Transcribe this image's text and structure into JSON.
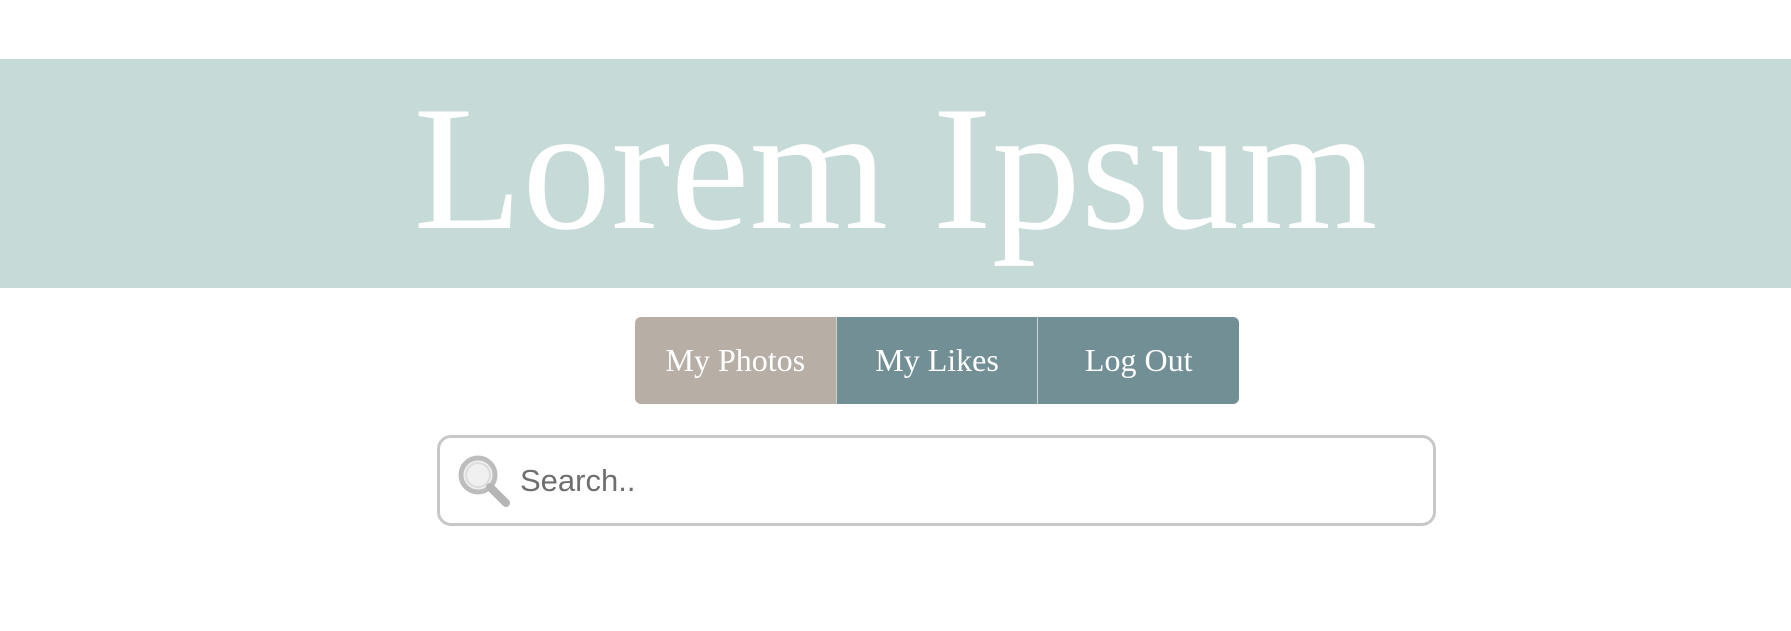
{
  "header": {
    "title": "Lorem Ipsum",
    "background_color": "#c6dad7"
  },
  "nav": {
    "items": [
      {
        "label": "My Photos",
        "active": true
      },
      {
        "label": "My Likes",
        "active": false
      },
      {
        "label": "Log Out",
        "active": false
      }
    ],
    "active_color": "#b7aea5",
    "color": "#738f96"
  },
  "search": {
    "placeholder": "Search..",
    "value": "",
    "icon": "search-icon"
  }
}
